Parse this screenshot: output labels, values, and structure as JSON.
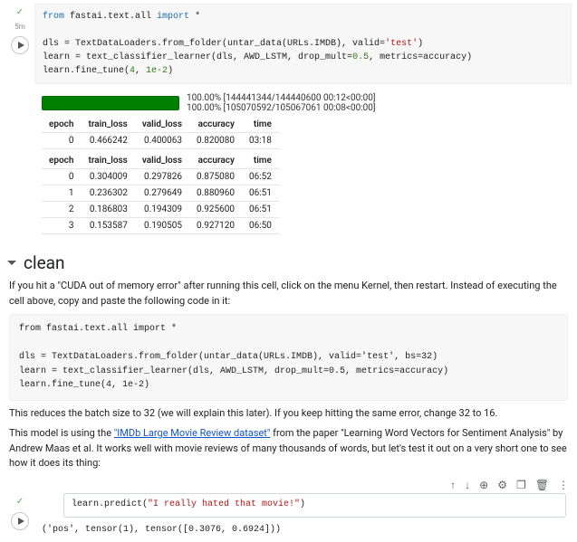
{
  "cell1": {
    "line1a": "from",
    "line1b": " fastai.text.all ",
    "line1c": "import",
    "line1d": " *",
    "line3a": "dls = TextDataLoaders.from_folder(untar_data(URLs.IMDB), valid=",
    "line3b": "'test'",
    "line3c": ")",
    "line4a": "learn = text_classifier_learner(dls, AWD_LSTM, drop_mult=",
    "line4b": "0.5",
    "line4c": ", metrics=accuracy)",
    "line5a": "learn.fine_tune(",
    "line5b": "4",
    "line5c": ", ",
    "line5d": "1e-2",
    "line5e": ")"
  },
  "progress": {
    "line1": "100.00% [144441344/144440600 00:12<00:00]",
    "line2": "100.00% [105070592/105067061 00:08<00:00]"
  },
  "table1": {
    "h0": "epoch",
    "h1": "train_loss",
    "h2": "valid_loss",
    "h3": "accuracy",
    "h4": "time",
    "r0c0": "0",
    "r0c1": "0.466242",
    "r0c2": "0.400063",
    "r0c3": "0.820080",
    "r0c4": "03:18"
  },
  "table2": {
    "h0": "epoch",
    "h1": "train_loss",
    "h2": "valid_loss",
    "h3": "accuracy",
    "h4": "time",
    "rows": [
      {
        "c0": "0",
        "c1": "0.304009",
        "c2": "0.297826",
        "c3": "0.875080",
        "c4": "06:52"
      },
      {
        "c0": "1",
        "c1": "0.236302",
        "c2": "0.279649",
        "c3": "0.880960",
        "c4": "06:51"
      },
      {
        "c0": "2",
        "c1": "0.186803",
        "c2": "0.194309",
        "c3": "0.925600",
        "c4": "06:51"
      },
      {
        "c0": "3",
        "c1": "0.153587",
        "c2": "0.190505",
        "c3": "0.927120",
        "c4": "06:50"
      }
    ]
  },
  "section": {
    "title": "clean"
  },
  "para1a": "If you hit a \"CUDA out of memory error\" after running this cell, click on the menu Kernel, then restart. Instead of executing the cell above, copy and paste the following code in it:",
  "codebox": "from fastai.text.all import *\n\ndls = TextDataLoaders.from_folder(untar_data(URLs.IMDB), valid='test', bs=32)\nlearn = text_classifier_learner(dls, AWD_LSTM, drop_mult=0.5, metrics=accuracy)\nlearn.fine_tune(4, 1e-2)",
  "para2": "This reduces the batch size to 32 (we will explain this later). If you keep hitting the same error, change 32 to 16.",
  "para3a": "This model is using the ",
  "para3link": "\"IMDb Large Movie Review dataset\"",
  "para3b": " from the paper \"Learning Word Vectors for Sentiment Analysis\" by Andrew Maas et al. It works well with movie reviews of many thousands of words, but let's test it out on a very short one to see how it does its thing:",
  "toolbar": {
    "up": "↑",
    "down": "↓",
    "link": "⊕",
    "gear": "⚙",
    "mirror": "❐",
    "trash": "🗑",
    "more": "⋮"
  },
  "cell2": {
    "a": "learn.predict(",
    "b": "\"I really hated that movie!\"",
    "c": ")"
  },
  "output2": "('pos', tensor(1), tensor([0.3076, 0.6924]))"
}
